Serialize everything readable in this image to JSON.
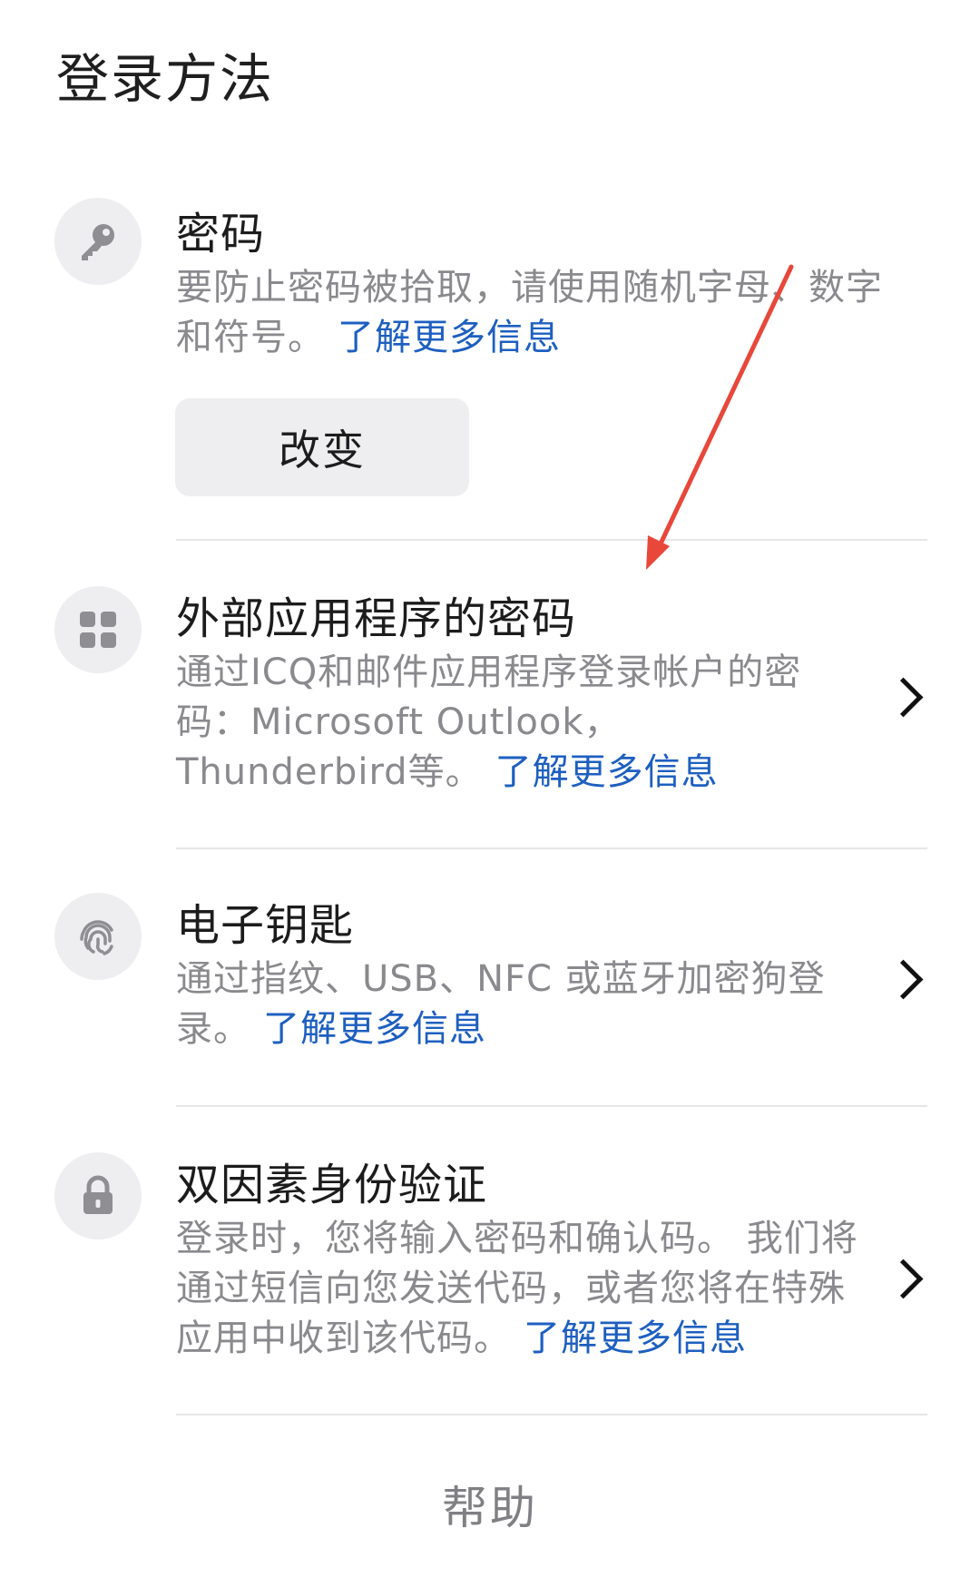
{
  "page_title": "登录方法",
  "sections": [
    {
      "title": "密码",
      "description": "要防止密码被拾取，请使用随机字母、数字和符号。",
      "learn_more": "了解更多信息",
      "button_label": "改变",
      "icon": "key-icon"
    },
    {
      "title": "外部应用程序的密码",
      "description": "通过ICQ和邮件应用程序登录帐户的密码：Microsoft Outlook，Thunderbird等。",
      "learn_more": "了解更多信息",
      "icon": "apps-grid-icon"
    },
    {
      "title": "电子钥匙",
      "description": "通过指纹、USB、NFC 或蓝牙加密狗登录。",
      "learn_more": "了解更多信息",
      "icon": "fingerprint-icon"
    },
    {
      "title": "双因素身份验证",
      "description": "登录时，您将输入密码和确认码。 我们将通过短信向您发送代码，或者您将在特殊应用中收到该代码。",
      "learn_more": "了解更多信息",
      "icon": "lock-icon"
    }
  ],
  "help_label": "帮助",
  "colors": {
    "accent": "#1e5fc0",
    "annotation_arrow": "#e8473a",
    "icon_circle": "#eeeef1"
  }
}
